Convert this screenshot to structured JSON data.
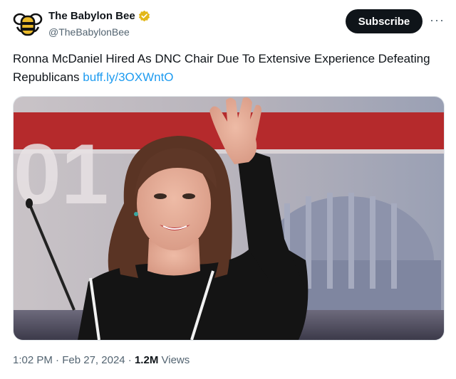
{
  "account": {
    "display_name": "The Babylon Bee",
    "handle": "@TheBabylonBee",
    "verified": true,
    "verified_color": "#e2b719",
    "avatar_icon": "bee-logo-icon"
  },
  "actions": {
    "subscribe_label": "Subscribe",
    "more_label": "···"
  },
  "tweet": {
    "text": "Ronna McDaniel Hired As DNC Chair Due To Extensive Experience Defeating Republicans",
    "link": "buff.ly/3OXWntO",
    "link_color": "#1d9bf0"
  },
  "meta": {
    "time": "1:02 PM",
    "separator": "·",
    "date": "Feb 27, 2024",
    "views_count": "1.2M",
    "views_label": "Views"
  },
  "colors": {
    "text": "#0f1419",
    "secondary": "#536471",
    "button_bg": "#0f1419"
  }
}
